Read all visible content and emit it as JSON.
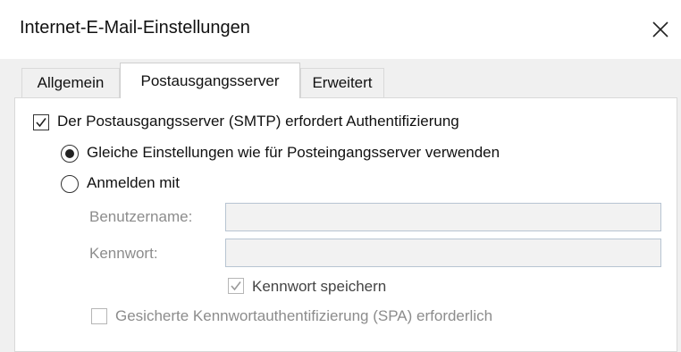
{
  "window": {
    "title": "Internet-E-Mail-Einstellungen"
  },
  "tabs": [
    {
      "label": "Allgemein",
      "active": false
    },
    {
      "label": "Postausgangsserver",
      "active": true
    },
    {
      "label": "Erweitert",
      "active": false
    }
  ],
  "smtp_auth": {
    "label": "Der Postausgangsserver (SMTP) erfordert Authentifizierung",
    "checked": true
  },
  "radio_same_settings": {
    "label": "Gleiche Einstellungen wie für Posteingangsserver verwenden",
    "selected": true
  },
  "radio_login_with": {
    "label": "Anmelden mit",
    "selected": false
  },
  "fields": {
    "username_label": "Benutzername:",
    "username_value": "",
    "password_label": "Kennwort:",
    "password_value": ""
  },
  "remember_password": {
    "label": "Kennwort speichern",
    "checked": true,
    "enabled": false
  },
  "spa": {
    "label": "Gesicherte Kennwortauthentifizierung (SPA) erforderlich",
    "checked": false,
    "enabled": false
  }
}
